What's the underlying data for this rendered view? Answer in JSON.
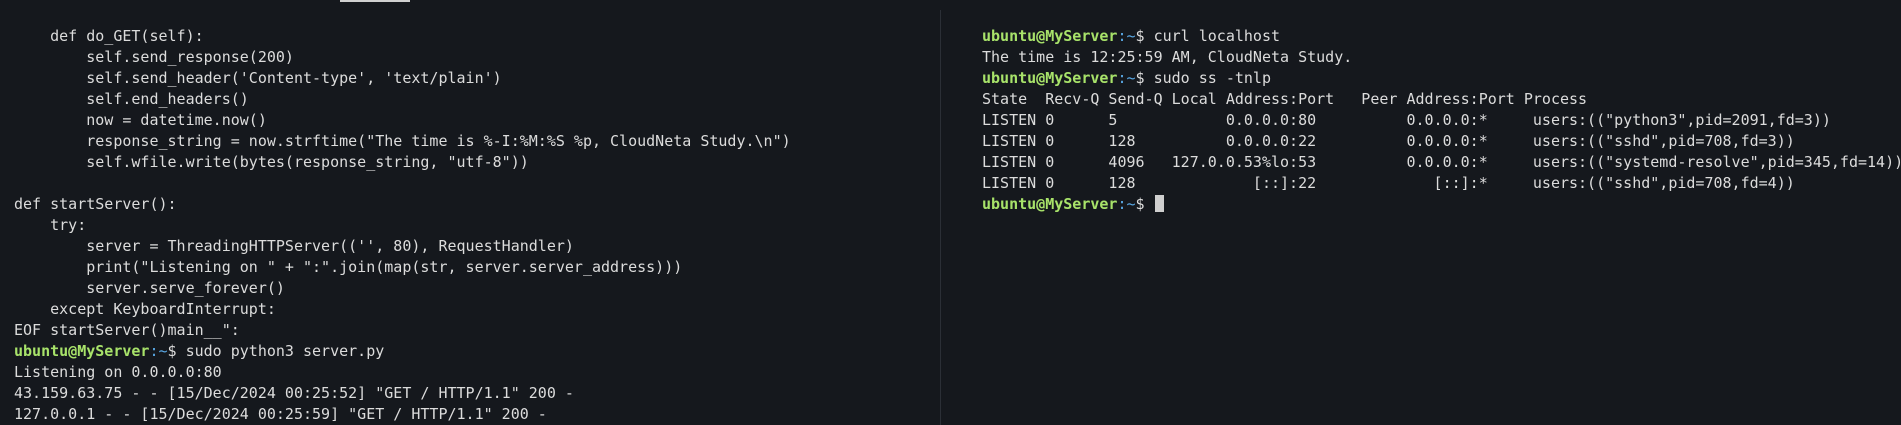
{
  "left_terminal": {
    "lines": [
      "    def do_GET(self):",
      "        self.send_response(200)",
      "        self.send_header('Content-type', 'text/plain')",
      "        self.end_headers()",
      "        now = datetime.now()",
      "        response_string = now.strftime(\"The time is %-I:%M:%S %p, CloudNeta Study.\\n\")",
      "        self.wfile.write(bytes(response_string, \"utf-8\"))",
      "",
      "def startServer():",
      "    try:",
      "        server = ThreadingHTTPServer(('', 80), RequestHandler)",
      "        print(\"Listening on \" + \":\".join(map(str, server.server_address)))",
      "        server.serve_forever()",
      "    except KeyboardInterrupt:",
      "EOF startServer()main__\":"
    ],
    "prompt": {
      "user": "ubuntu@MyServer",
      "path": ":~",
      "dollar": "$ ",
      "command": "sudo python3 server.py"
    },
    "output": [
      "Listening on 0.0.0.0:80",
      "43.159.63.75 - - [15/Dec/2024 00:25:52] \"GET / HTTP/1.1\" 200 -",
      "127.0.0.1 - - [15/Dec/2024 00:25:59] \"GET / HTTP/1.1\" 200 -"
    ]
  },
  "right_terminal": {
    "prompt_user": "ubuntu@MyServer",
    "prompt_path": ":~",
    "prompt_dollar": "$ ",
    "cmd1": "curl localhost",
    "cmd1_output": "The time is 12:25:59 AM, CloudNeta Study.",
    "cmd2": "sudo ss -tnlp",
    "table_header": "State  Recv-Q Send-Q Local Address:Port   Peer Address:Port Process",
    "table_rows": [
      "LISTEN 0      5            0.0.0.0:80          0.0.0.0:*     users:((\"python3\",pid=2091,fd=3))",
      "LISTEN 0      128          0.0.0.0:22          0.0.0.0:*     users:((\"sshd\",pid=708,fd=3))",
      "LISTEN 0      4096   127.0.0.53%lo:53          0.0.0.0:*     users:((\"systemd-resolve\",pid=345,fd=14))",
      "LISTEN 0      128             [::]:22             [::]:*     users:((\"sshd\",pid=708,fd=4))"
    ]
  },
  "colors": {
    "background": "#15181d",
    "text": "#dcdcdc",
    "prompt_user": "#a8e36a",
    "prompt_path": "#5aa9e6"
  }
}
